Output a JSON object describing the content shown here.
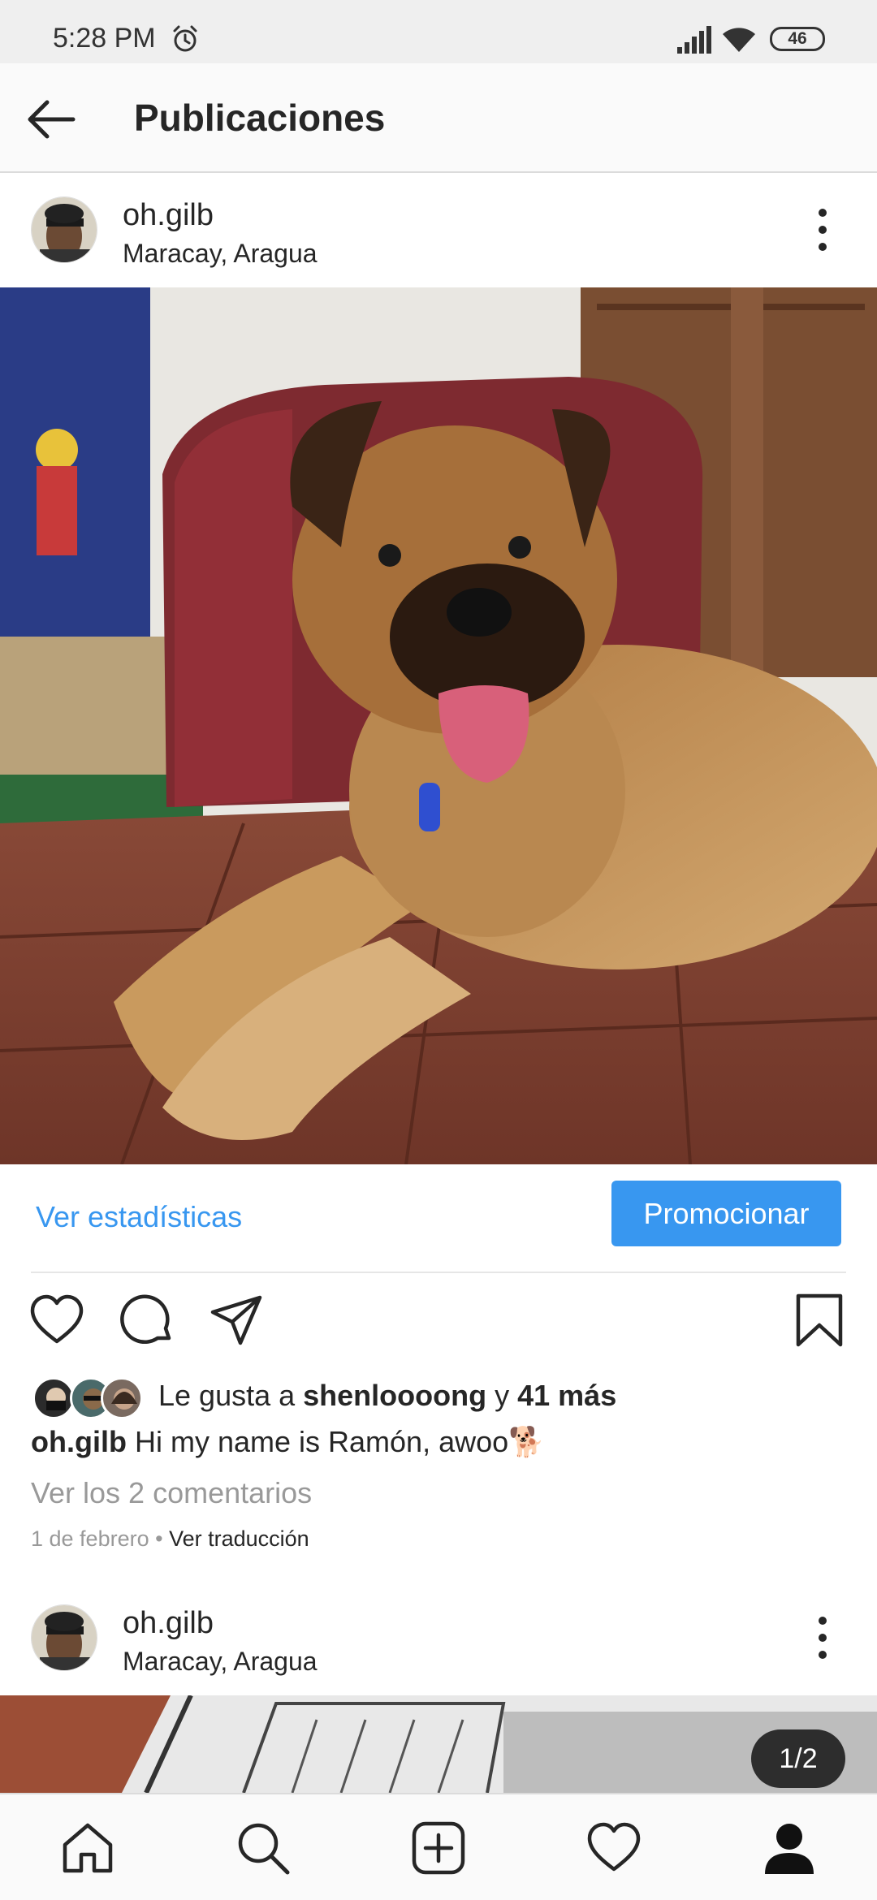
{
  "status_bar": {
    "time": "5:28 PM",
    "battery": "46",
    "icons": [
      "alarm-icon",
      "signal-icon",
      "wifi-icon",
      "battery-icon"
    ]
  },
  "header": {
    "title": "Publicaciones",
    "back_icon": "arrow-left-icon"
  },
  "posts": [
    {
      "username": "oh.gilb",
      "location": "Maracay, Aragua"
    },
    {
      "username": "oh.gilb",
      "location": "Maracay, Aragua"
    }
  ],
  "insights": {
    "link": "Ver estadísticas",
    "promote": "Promocionar"
  },
  "likes": {
    "prefix": "Le gusta a ",
    "user": "shenloooong",
    "middle": " y ",
    "count": "41 más"
  },
  "caption": {
    "username": "oh.gilb",
    "text": " Hi my name is Ramón, awoo🐕"
  },
  "comments_link": "Ver los 2 comentarios",
  "meta": {
    "date": "1 de febrero",
    "separator": " • ",
    "translate": "Ver traducción"
  },
  "carousel": {
    "counter": "1/2"
  },
  "colors": {
    "accent": "#3897f0",
    "text": "#262626",
    "muted": "#999999"
  },
  "bottom_nav": [
    "home-icon",
    "search-icon",
    "new-post-icon",
    "activity-heart-icon",
    "profile-icon"
  ]
}
